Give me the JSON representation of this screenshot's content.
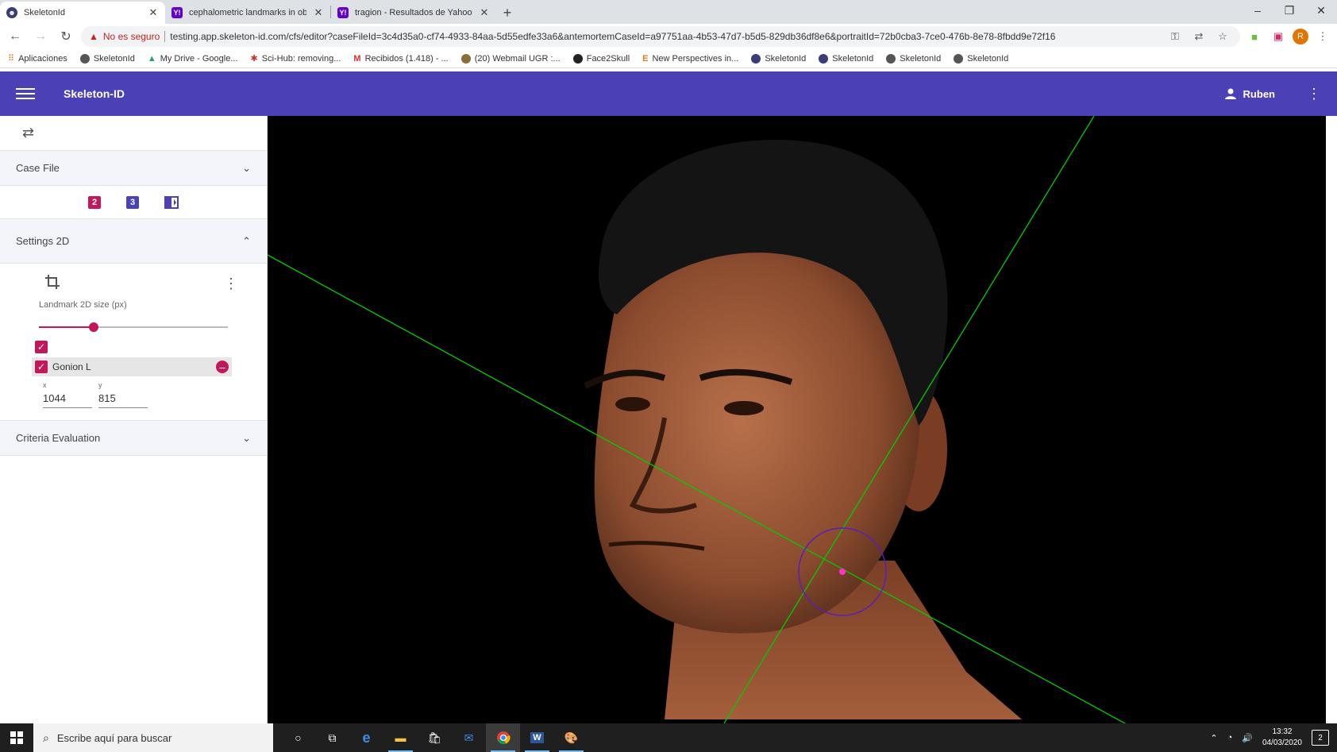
{
  "browser": {
    "tabs": [
      {
        "title": "SkeletonId",
        "favicon": "skeleton-favicon",
        "active": true
      },
      {
        "title": "cephalometric landmarks in oblic",
        "favicon": "yahoo-favicon",
        "active": false
      },
      {
        "title": "tragion - Resultados de Yahoo Es",
        "favicon": "yahoo-favicon",
        "active": false
      }
    ],
    "security_label": "No es seguro",
    "url": "testing.app.skeleton-id.com/cfs/editor?caseFileId=3c4d35a0-cf74-4933-84aa-5d55edfe33a6&antemortemCaseId=a97751aa-4b53-47d7-b5d5-829db36df8e6&portraitId=72b0cba3-7ce0-476b-8e78-8fbdd9e72f16",
    "profile_initial": "R",
    "bookmarks": [
      "Aplicaciones",
      "SkeletonId",
      "My Drive - Google...",
      "Sci-Hub: removing...",
      "Recibidos (1.418) - ...",
      "(20) Webmail UGR :...",
      "Face2Skull",
      "New Perspectives in...",
      "SkeletonId",
      "SkeletonId",
      "SkeletonId",
      "SkeletonId"
    ]
  },
  "app": {
    "title": "Skeleton-ID",
    "user": "Ruben"
  },
  "sidebar": {
    "case_file_label": "Case File",
    "case_icons": {
      "icon2": "2",
      "icon3": "3"
    },
    "settings_label": "Settings 2D",
    "landmark_size_label": "Landmark 2D size (px)",
    "landmark_size_fraction": 0.29,
    "landmark": {
      "name": "Gonion L",
      "x_label": "x",
      "y_label": "y",
      "x": "1044",
      "y": "815"
    },
    "criteria_label": "Criteria Evaluation"
  },
  "taskbar": {
    "search_placeholder": "Escribe aquí para buscar",
    "time": "13:32",
    "date": "04/03/2020",
    "notifications": "2"
  },
  "colors": {
    "appbar": "#4a41b6",
    "accent": "#c2185b",
    "guide_line": "#00cc00",
    "landmark_circle": "#5a1fb8",
    "landmark_dot": "#ff33cc"
  }
}
